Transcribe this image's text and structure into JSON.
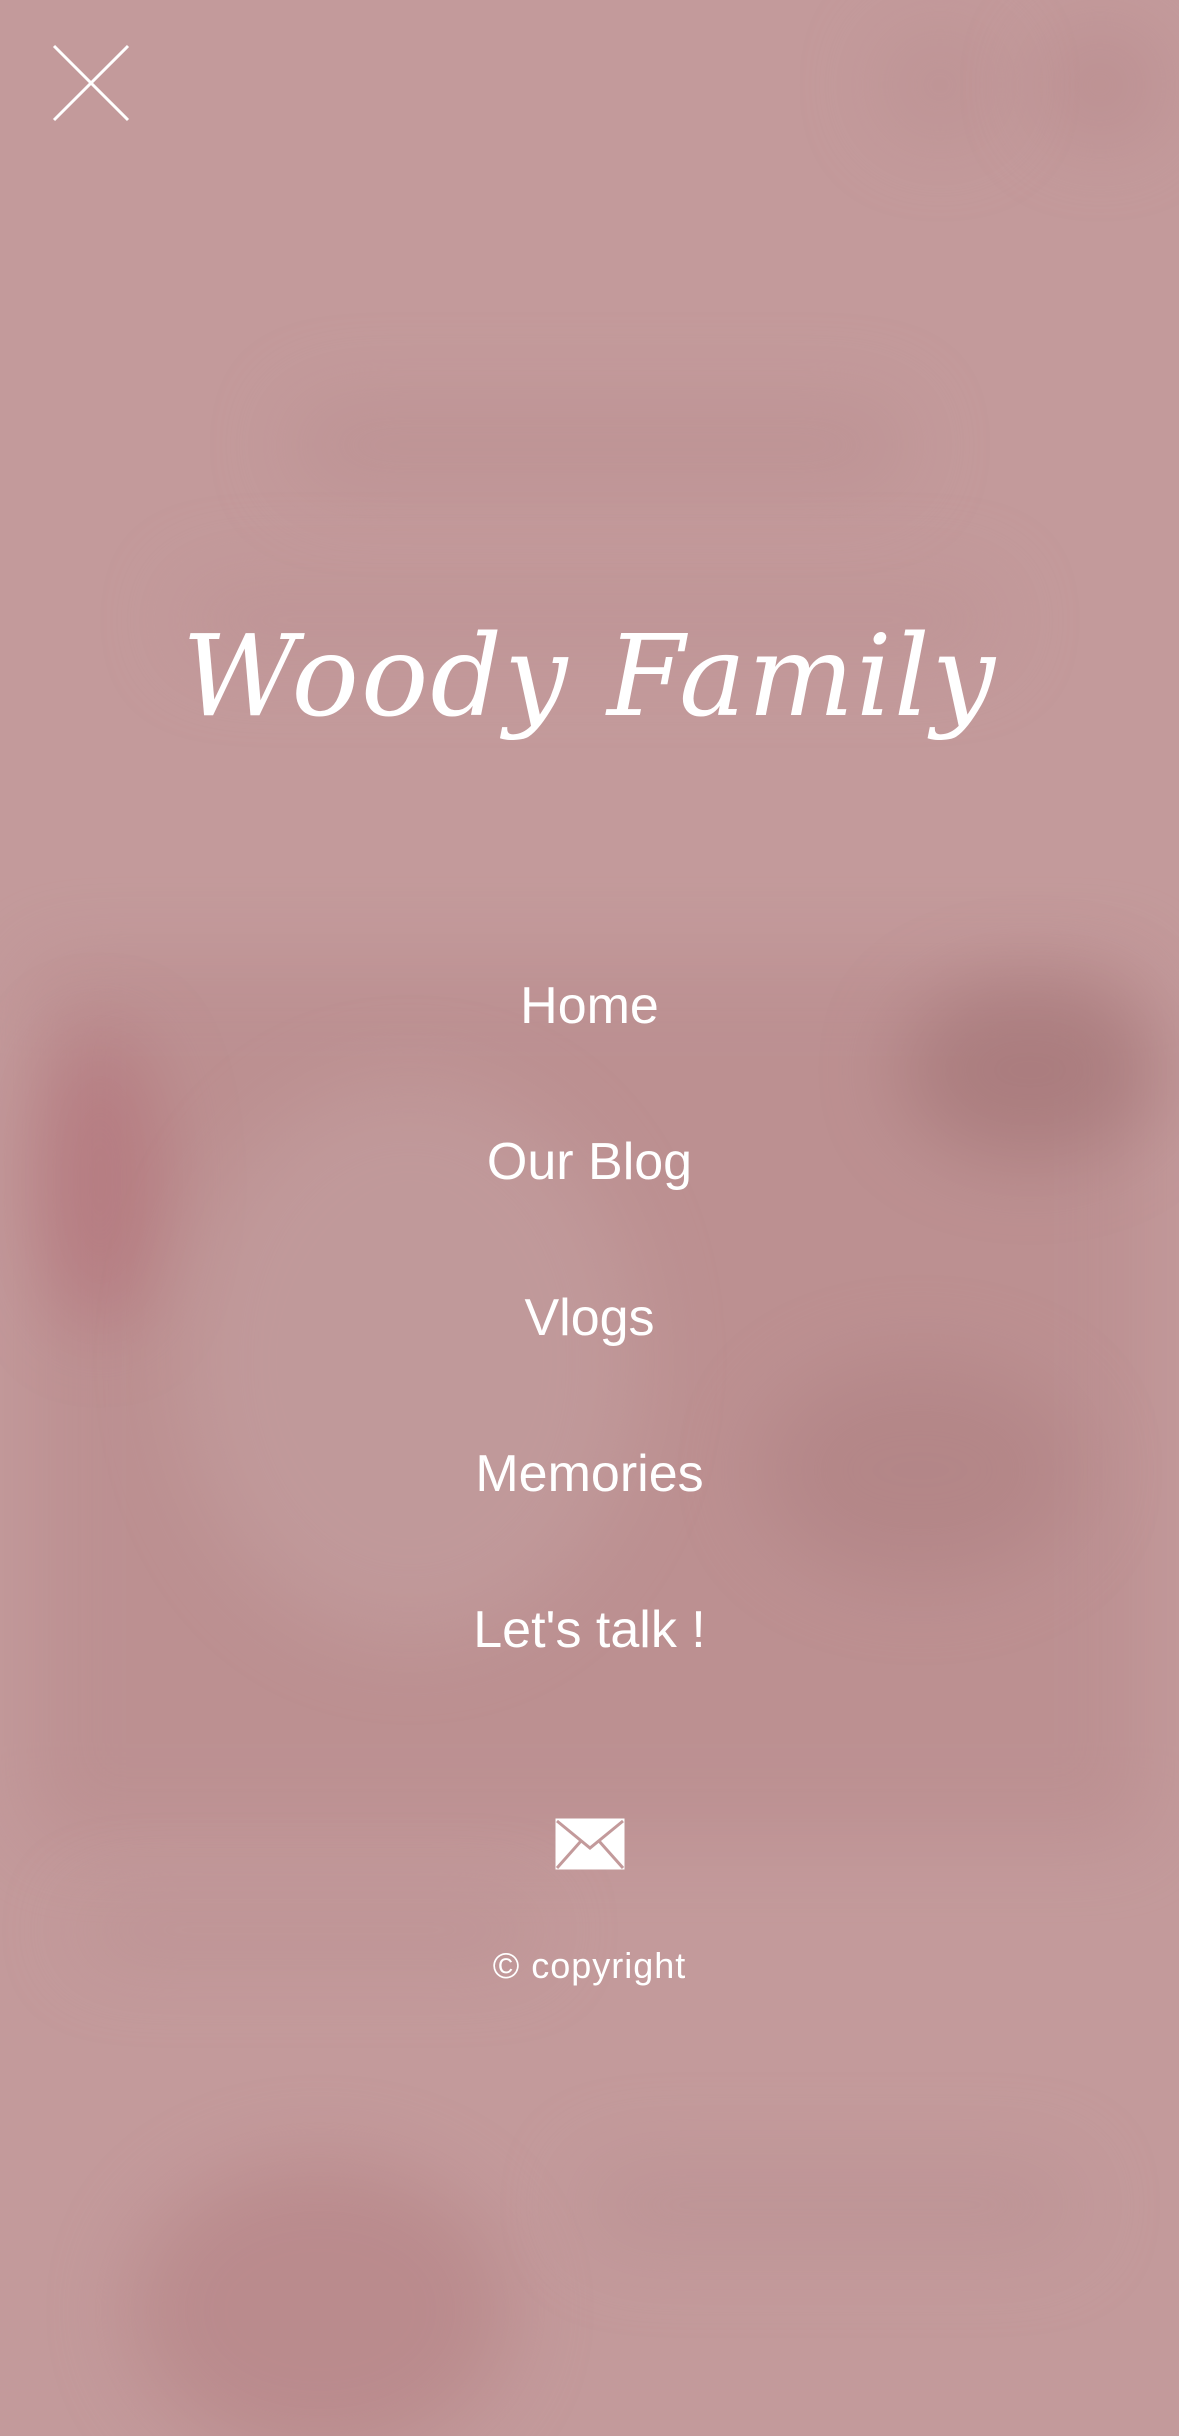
{
  "brand": {
    "title": "Woody Family"
  },
  "menu": {
    "close_icon": "close-icon",
    "items": [
      {
        "label": "Home"
      },
      {
        "label": "Our Blog"
      },
      {
        "label": "Vlogs"
      },
      {
        "label": "Memories"
      },
      {
        "label": "Let's talk !"
      }
    ]
  },
  "footer": {
    "mail_icon": "envelope-icon",
    "copyright": "© copyright"
  },
  "colors": {
    "overlay": "#c39a9b",
    "text": "#ffffff"
  }
}
